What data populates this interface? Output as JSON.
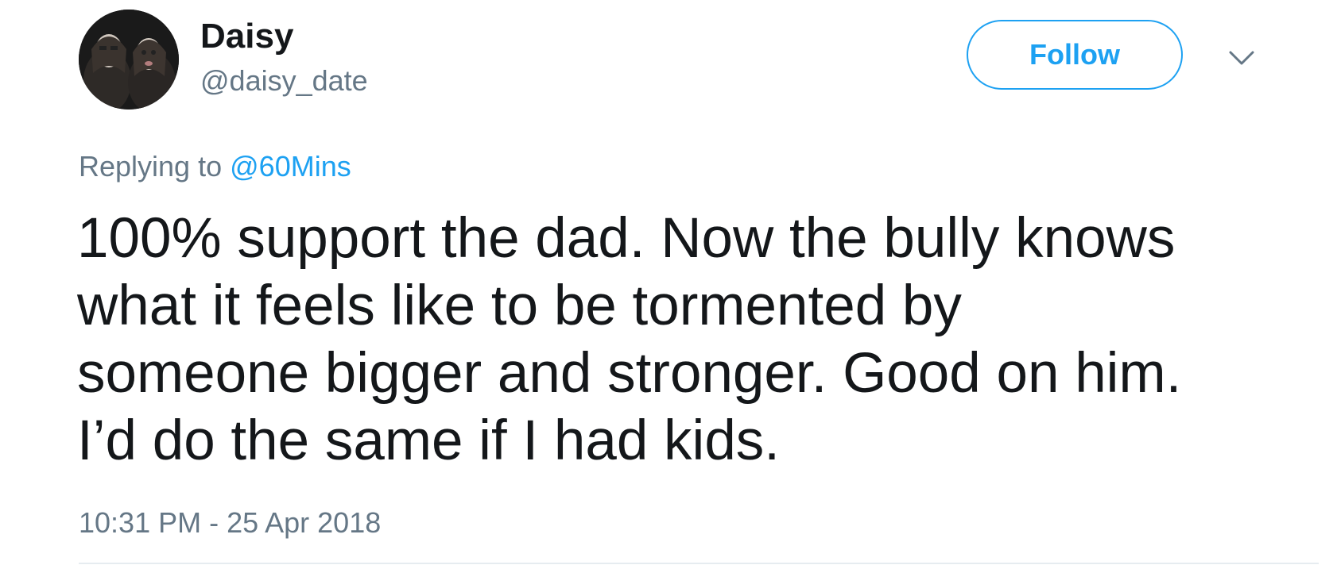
{
  "user": {
    "display_name": "Daisy",
    "handle": "@daisy_date"
  },
  "follow_button": {
    "label": "Follow"
  },
  "menu": {
    "icon": "chevron-down-icon"
  },
  "reply_context": {
    "prefix": "Replying to",
    "mention": "@60Mins"
  },
  "tweet": {
    "text_lines": [
      "100% support the dad. Now the bully knows",
      "what it feels like to be tormented by",
      "someone bigger and stronger. Good on him.",
      "I’d do the same if I had kids."
    ],
    "timestamp": "10:31 PM - 25 Apr 2018"
  },
  "colors": {
    "accent": "#1da1f2",
    "text": "#14171a",
    "secondary_text": "#657786",
    "divider": "#e6ecf0"
  }
}
